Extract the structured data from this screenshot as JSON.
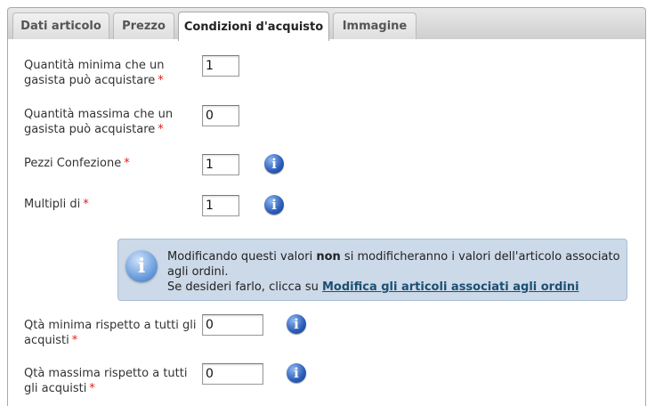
{
  "tabs": [
    {
      "label": "Dati articolo"
    },
    {
      "label": "Prezzo"
    },
    {
      "label": "Condizioni d'acquisto"
    },
    {
      "label": "Immagine"
    }
  ],
  "fields": {
    "qta_minima": {
      "label": "Quantità minima che un gasista può acquistare",
      "value": "1"
    },
    "qta_massima": {
      "label": "Quantità massima che un gasista può acquistare",
      "value": "0"
    },
    "pezzi_confezione": {
      "label": "Pezzi Confezione",
      "value": "1"
    },
    "multipli": {
      "label": "Multipli di",
      "value": "1"
    },
    "qta_minima_tutti": {
      "label": "Qtà minima rispetto a tutti gli acquisti",
      "value": "0"
    },
    "qta_massima_tutti": {
      "label": "Qtà massima rispetto a tutti gli acquisti",
      "value": "0"
    }
  },
  "required_mark": "*",
  "info_glyph": "i",
  "note": {
    "line1_pre": "Modificando questi valori ",
    "line1_bold": "non",
    "line1_post": " si modificheranno i valori dell'articolo associato agli ordini.",
    "line2_pre": "Se desideri farlo, clicca su ",
    "link": "Modifica gli articoli associati agli ordini"
  },
  "colors": {
    "required": "#e0201b",
    "note_bg": "#ccd9e8",
    "link": "#1c4f72"
  }
}
